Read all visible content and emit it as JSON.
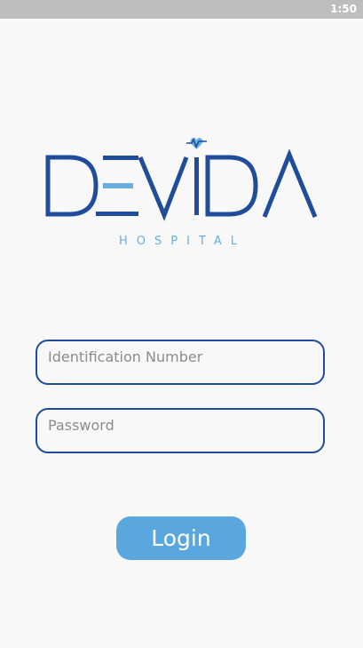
{
  "status_bar": {
    "time": "1:50"
  },
  "logo": {
    "name": "DEVIDA",
    "tagline": "HOSPITAL",
    "colors": {
      "primary": "#1f4c9b",
      "accent": "#6aaee0"
    }
  },
  "form": {
    "identification_placeholder": "Identification Number",
    "identification_value": "",
    "password_placeholder": "Password",
    "password_value": "",
    "login_label": "Login"
  },
  "colors": {
    "background": "#f8f8f8",
    "field_border": "#1f4c9b",
    "button": "#5aa7df"
  }
}
